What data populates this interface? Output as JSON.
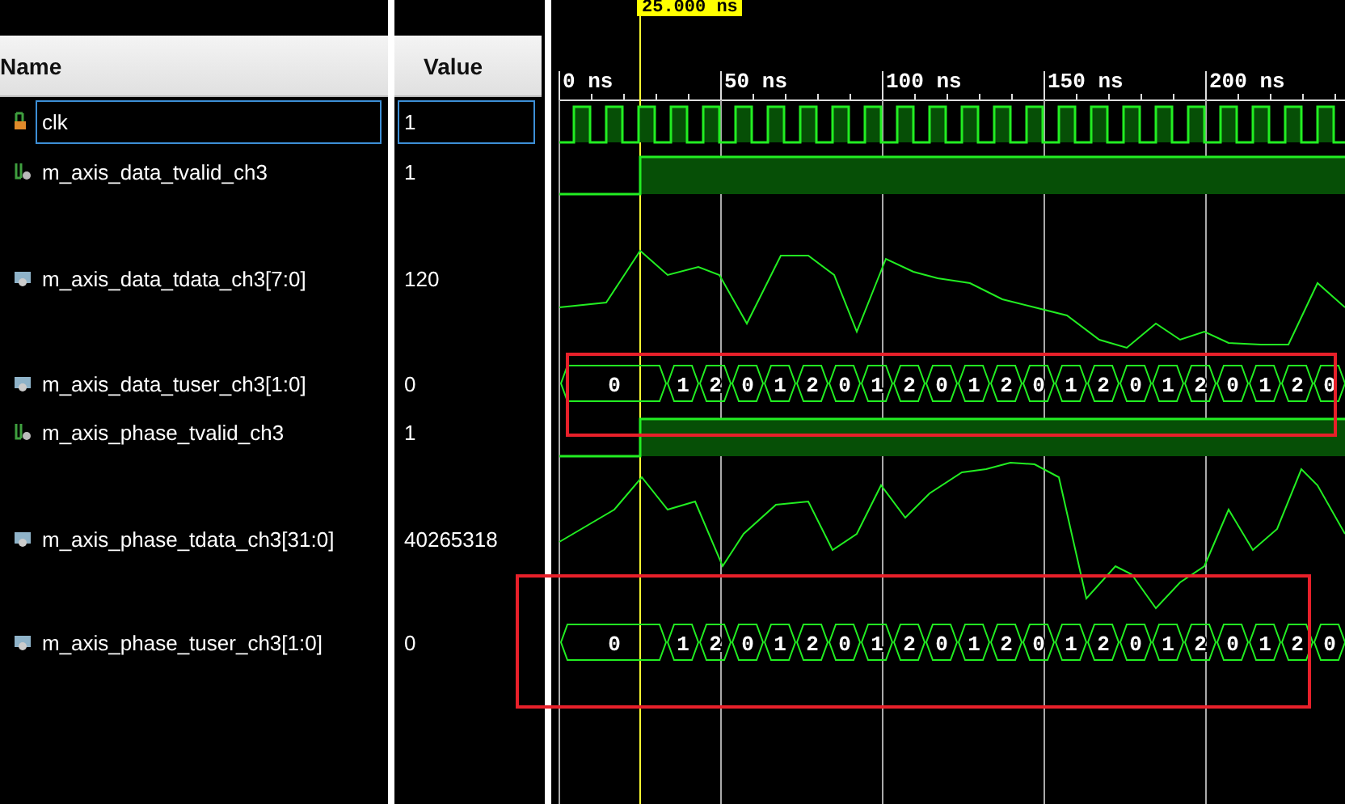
{
  "cursor": {
    "label": "25.000 ns"
  },
  "columns": {
    "name": "Name",
    "value": "Value"
  },
  "ruler": {
    "labels": [
      "0 ns",
      "50 ns",
      "100 ns",
      "150 ns",
      "200 ns"
    ]
  },
  "signals": [
    {
      "name": "clk",
      "value": "1",
      "kind": "clock",
      "selected": true,
      "highlighted": false
    },
    {
      "name": "m_axis_data_tvalid_ch3",
      "value": "1",
      "kind": "bit",
      "selected": false,
      "highlighted": false
    },
    {
      "name": "m_axis_data_tdata_ch3[7:0]",
      "value": "120",
      "kind": "analog",
      "selected": false,
      "highlighted": false
    },
    {
      "name": "m_axis_data_tuser_ch3[1:0]",
      "value": "0",
      "kind": "bus",
      "selected": false,
      "highlighted": true,
      "values": [
        "0",
        "1",
        "2",
        "0",
        "1",
        "2",
        "0",
        "1",
        "2",
        "0",
        "1",
        "2",
        "0",
        "1",
        "2",
        "0",
        "1",
        "2",
        "0",
        "1",
        "2",
        "0"
      ]
    },
    {
      "name": "m_axis_phase_tvalid_ch3",
      "value": "1",
      "kind": "bit",
      "selected": false,
      "highlighted": false
    },
    {
      "name": "m_axis_phase_tdata_ch3[31:0]",
      "value": "40265318",
      "kind": "analog",
      "selected": false,
      "highlighted": false
    },
    {
      "name": "m_axis_phase_tuser_ch3[1:0]",
      "value": "0",
      "kind": "bus",
      "selected": false,
      "highlighted": true,
      "values": [
        "0",
        "1",
        "2",
        "0",
        "1",
        "2",
        "0",
        "1",
        "2",
        "0",
        "1",
        "2",
        "0",
        "1",
        "2",
        "0",
        "1",
        "2",
        "0",
        "1",
        "2",
        "0"
      ]
    }
  ]
}
